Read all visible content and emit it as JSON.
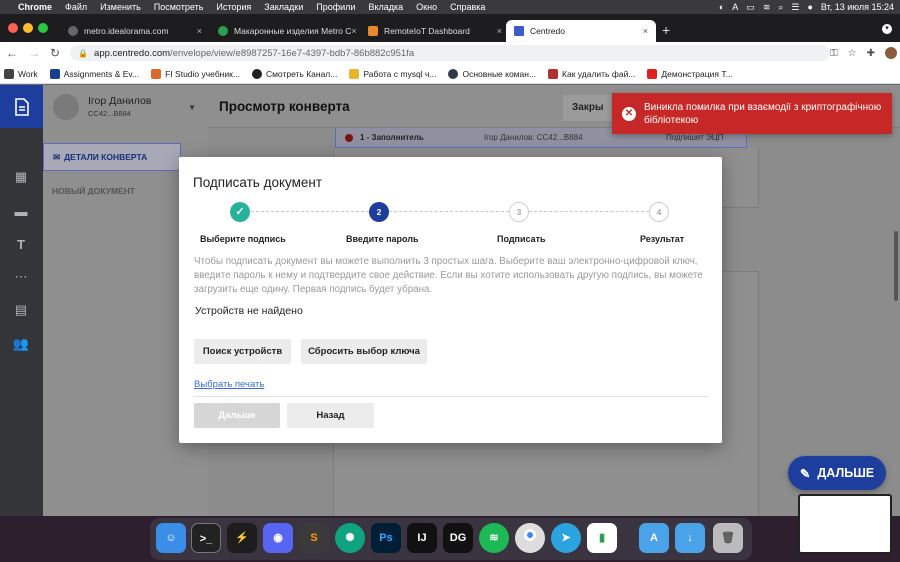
{
  "menubar": {
    "app": "Chrome",
    "items": [
      "Файл",
      "Изменить",
      "Посмотреть",
      "История",
      "Закладки",
      "Профили",
      "Вкладка",
      "Окно",
      "Справка"
    ],
    "clock": "Вт, 13 июля  15:24"
  },
  "tabs": [
    {
      "title": "metro.idealorama.com",
      "close": "×",
      "color": "#555555"
    },
    {
      "title": "Макаронные изделия Metro C",
      "close": "×",
      "color": "#2e9e4f"
    },
    {
      "title": "RemoteIoT Dashboard",
      "close": "×",
      "color": "#e8892b"
    },
    {
      "title": "Centredo",
      "close": "×",
      "color": "#3b5bcc"
    }
  ],
  "newtab": "+",
  "address": {
    "host": "app.centredo.com",
    "path": "/envelope/view/e8987257-16e7-4397-bdb7-86b882c951fa"
  },
  "bookmarks": [
    {
      "label": "Work",
      "color": "#444444"
    },
    {
      "label": "Assignments & Ev...",
      "color": "#1a3f8f"
    },
    {
      "label": "FI Studio учебник...",
      "color": "#d9682a"
    },
    {
      "label": "Смотреть Канал...",
      "color": "#222222"
    },
    {
      "label": "Работа с mysql ч...",
      "color": "#e8b62b"
    },
    {
      "label": "Основные коман...",
      "color": "#2e3a48"
    },
    {
      "label": "Как удалить фай...",
      "color": "#b23030"
    },
    {
      "label": "Демонстрация Т...",
      "color": "#e02020"
    }
  ],
  "user": {
    "name": "Ігор Данилов",
    "id": "CC42...B884"
  },
  "nav": {
    "details": "ДЕТАЛИ КОНВЕРТА",
    "new_doc": "НОВЫЙ ДОКУМЕНТ"
  },
  "header": {
    "title": "Просмотр конверта",
    "close_btn": "Закры"
  },
  "background_card": {
    "step": "1 - Заполнитель",
    "user": "Ігор Данилов: CC42...B884",
    "tail": "Подпишет ЭЦП"
  },
  "fab": {
    "label": "ДАЛЬШЕ"
  },
  "toast": {
    "message": "Виникла помилка при взаємодії з криптографічною бібліотекою"
  },
  "modal": {
    "title": "Подписать документ",
    "steps": [
      {
        "num": "✓",
        "label": "Выберите подпись",
        "state": "done"
      },
      {
        "num": "2",
        "label": "Введите пароль",
        "state": "active"
      },
      {
        "num": "3",
        "label": "Подписать",
        "state": "future"
      },
      {
        "num": "4",
        "label": "Результат",
        "state": "future"
      }
    ],
    "instructions": "Чтобы подписать документ вы можете выполнить 3 простых шага. Выберите ваш электронно-цифровой ключ, введите пароль к нему и подтвердите свое действие. Если вы хотите использовать другую подпись, вы можете загрузить еще одину. Первая подпись будет убрана.",
    "no_devices": "Устройств не найдено",
    "search_btn": "Поиск устройств",
    "reset_btn": "Сбросить выбор ключа",
    "print_link": "Выбрать печать",
    "next_btn": "Дальше",
    "back_btn": "Назад"
  },
  "colors": {
    "primary": "#1e3e9e",
    "success": "#26b39a",
    "error": "#c62828"
  }
}
